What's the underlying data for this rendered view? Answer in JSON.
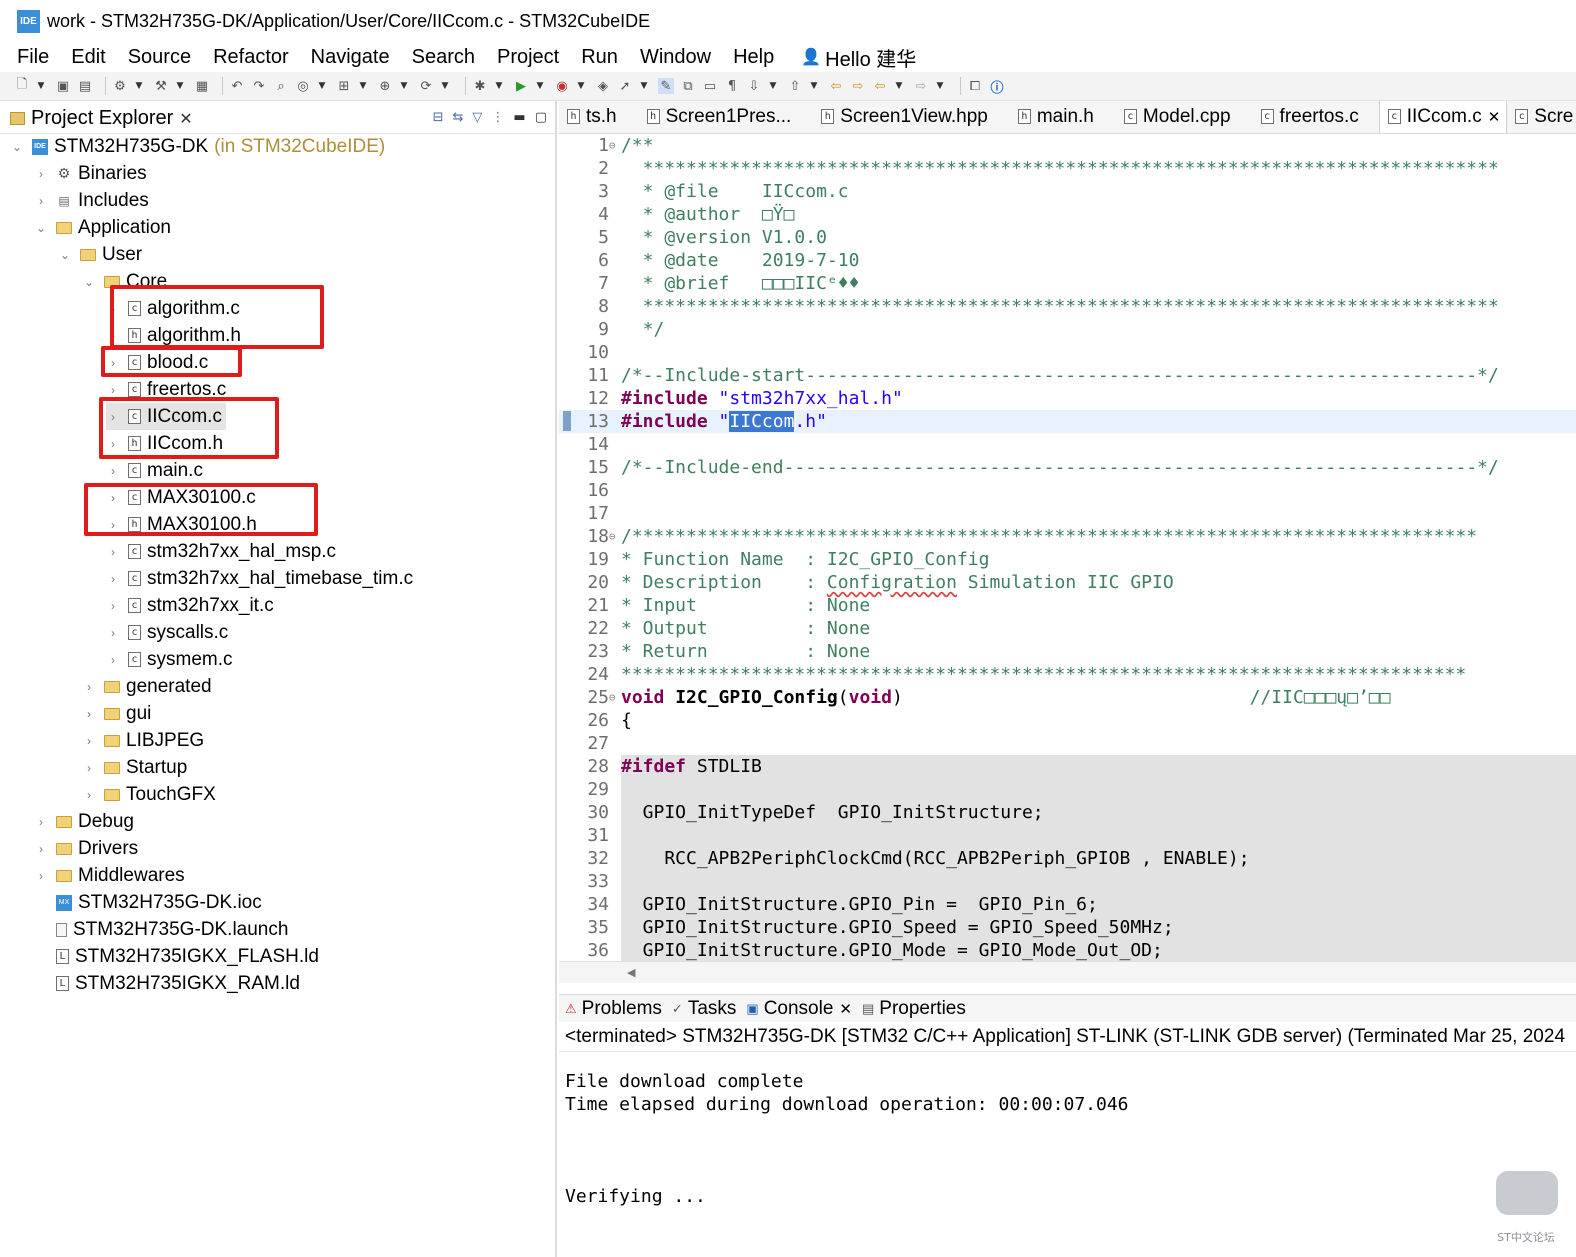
{
  "window": {
    "logo": "IDE",
    "title": "work - STM32H735G-DK/Application/User/Core/IICcom.c - STM32CubeIDE"
  },
  "menu": {
    "items": [
      "File",
      "Edit",
      "Source",
      "Refactor",
      "Navigate",
      "Search",
      "Project",
      "Run",
      "Window",
      "Help"
    ],
    "user": "Hello 建华"
  },
  "project_explorer": {
    "title": "Project Explorer",
    "project": "STM32H735G-DK",
    "project_suffix": "(in STM32CubeIDE)",
    "items": [
      {
        "label": "Binaries"
      },
      {
        "label": "Includes"
      },
      {
        "label": "Application"
      },
      {
        "label": "User"
      },
      {
        "label": "Core"
      },
      {
        "label": "algorithm.c"
      },
      {
        "label": "algorithm.h"
      },
      {
        "label": "blood.c"
      },
      {
        "label": "freertos.c"
      },
      {
        "label": "IICcom.c"
      },
      {
        "label": "IICcom.h"
      },
      {
        "label": "main.c"
      },
      {
        "label": "MAX30100.c"
      },
      {
        "label": "MAX30100.h"
      },
      {
        "label": "stm32h7xx_hal_msp.c"
      },
      {
        "label": "stm32h7xx_hal_timebase_tim.c"
      },
      {
        "label": "stm32h7xx_it.c"
      },
      {
        "label": "syscalls.c"
      },
      {
        "label": "sysmem.c"
      },
      {
        "label": "generated"
      },
      {
        "label": "gui"
      },
      {
        "label": "LIBJPEG"
      },
      {
        "label": "Startup"
      },
      {
        "label": "TouchGFX"
      },
      {
        "label": "Debug"
      },
      {
        "label": "Drivers"
      },
      {
        "label": "Middlewares"
      },
      {
        "label": "STM32H735G-DK.ioc"
      },
      {
        "label": "STM32H735G-DK.launch"
      },
      {
        "label": "STM32H735IGKX_FLASH.ld"
      },
      {
        "label": "STM32H735IGKX_RAM.ld"
      }
    ]
  },
  "editor": {
    "tabs": [
      "ts.h",
      "Screen1Pres...",
      "Screen1View.hpp",
      "main.h",
      "Model.cpp",
      "freertos.c",
      "IICcom.c",
      "Scre"
    ],
    "active_tab": "IICcom.c",
    "lines": [
      {
        "n": "1",
        "segs": [
          {
            "t": "/**",
            "c": "com"
          }
        ],
        "fold": "⊖"
      },
      {
        "n": "2",
        "segs": [
          {
            "t": "  *******************************************************************************",
            "c": "com"
          }
        ]
      },
      {
        "n": "3",
        "segs": [
          {
            "t": "  * @file    IICcom.c",
            "c": "com"
          }
        ]
      },
      {
        "n": "4",
        "segs": [
          {
            "t": "  * @author  □Ÿ□",
            "c": "com"
          }
        ]
      },
      {
        "n": "5",
        "segs": [
          {
            "t": "  * @version V1.0.0",
            "c": "com"
          }
        ]
      },
      {
        "n": "6",
        "segs": [
          {
            "t": "  * @date    2019-7-10",
            "c": "com"
          }
        ]
      },
      {
        "n": "7",
        "segs": [
          {
            "t": "  * @brief   □□□IICᵉ♦♦",
            "c": "com"
          }
        ]
      },
      {
        "n": "8",
        "segs": [
          {
            "t": "  *******************************************************************************",
            "c": "com"
          }
        ]
      },
      {
        "n": "9",
        "segs": [
          {
            "t": "  */",
            "c": "com"
          }
        ]
      },
      {
        "n": "10",
        "segs": []
      },
      {
        "n": "11",
        "segs": [
          {
            "t": "/*--Include-start--------------------------------------------------------------*/",
            "c": "com"
          }
        ]
      },
      {
        "n": "12",
        "segs": [
          {
            "t": "#include",
            "c": "kw"
          },
          {
            "t": " "
          },
          {
            "t": "\"stm32h7xx_hal.h\"",
            "c": "str"
          }
        ]
      },
      {
        "n": "13",
        "hl": true,
        "segs": [
          {
            "t": "#include",
            "c": "kw"
          },
          {
            "t": " "
          },
          {
            "t": "\"",
            "c": "str"
          },
          {
            "t": "IICcom",
            "c": "selword"
          },
          {
            "t": ".h\"",
            "c": "str"
          }
        ]
      },
      {
        "n": "14",
        "segs": []
      },
      {
        "n": "15",
        "segs": [
          {
            "t": "/*--Include-end----------------------------------------------------------------*/",
            "c": "com"
          }
        ]
      },
      {
        "n": "16",
        "segs": []
      },
      {
        "n": "17",
        "segs": []
      },
      {
        "n": "18",
        "fold": "⊖",
        "segs": [
          {
            "t": "/******************************************************************************",
            "c": "com"
          }
        ]
      },
      {
        "n": "19",
        "segs": [
          {
            "t": "* Function Name  : I2C_GPIO_Config",
            "c": "com"
          }
        ]
      },
      {
        "n": "20",
        "segs": [
          {
            "t": "* Description    : ",
            "c": "com"
          },
          {
            "t": "Configration",
            "c": "comsq"
          },
          {
            "t": " Simulation IIC GPIO",
            "c": "com"
          }
        ]
      },
      {
        "n": "21",
        "segs": [
          {
            "t": "* Input          : None",
            "c": "com"
          }
        ]
      },
      {
        "n": "22",
        "segs": [
          {
            "t": "* Output         : None",
            "c": "com"
          }
        ]
      },
      {
        "n": "23",
        "segs": [
          {
            "t": "* Return         : None",
            "c": "com"
          }
        ]
      },
      {
        "n": "24",
        "segs": [
          {
            "t": "****************************************************************************** ",
            "c": "com"
          }
        ]
      },
      {
        "n": "25",
        "fold": "⊖",
        "segs": [
          {
            "t": "void",
            "c": "kw"
          },
          {
            "t": " "
          },
          {
            "t": "I2C_GPIO_Config",
            "c": "fn"
          },
          {
            "t": "("
          },
          {
            "t": "void",
            "c": "kw"
          },
          {
            "t": ")"
          },
          {
            "t": "                                //IIC□□□ų□’□□",
            "c": "com"
          }
        ]
      },
      {
        "n": "26",
        "segs": [
          {
            "t": "{"
          }
        ]
      },
      {
        "n": "27",
        "segs": []
      },
      {
        "n": "28",
        "shade": true,
        "segs": [
          {
            "t": "#ifdef",
            "c": "kw"
          },
          {
            "t": " STDLIB"
          }
        ]
      },
      {
        "n": "29",
        "shade": true,
        "segs": []
      },
      {
        "n": "30",
        "shade": true,
        "segs": [
          {
            "t": "  GPIO_InitTypeDef  GPIO_InitStructure;"
          }
        ]
      },
      {
        "n": "31",
        "shade": true,
        "segs": []
      },
      {
        "n": "32",
        "shade": true,
        "segs": [
          {
            "t": "    RCC_APB2PeriphClockCmd(RCC_APB2Periph_GPIOB , ENABLE);"
          }
        ]
      },
      {
        "n": "33",
        "shade": true,
        "segs": []
      },
      {
        "n": "34",
        "shade": true,
        "segs": [
          {
            "t": "  GPIO_InitStructure.GPIO_Pin =  GPIO_Pin_6;"
          }
        ]
      },
      {
        "n": "35",
        "shade": true,
        "segs": [
          {
            "t": "  GPIO_InitStructure.GPIO_Speed = GPIO_Speed_50MHz;"
          }
        ]
      },
      {
        "n": "36",
        "shade": true,
        "segs": [
          {
            "t": "  GPIO_InitStructure.GPIO_Mode = GPIO_Mode_Out_OD;"
          }
        ]
      }
    ]
  },
  "console": {
    "tabs": [
      "Problems",
      "Tasks",
      "Console",
      "Properties"
    ],
    "active_tab": "Console",
    "header": "<terminated> STM32H735G-DK [STM32 C/C++ Application] ST-LINK (ST-LINK GDB server) (Terminated Mar 25, 2024",
    "lines": [
      "File download complete",
      "Time elapsed during download operation: 00:00:07.046",
      "",
      "",
      "",
      "Verifying ..."
    ]
  },
  "watermark": {
    "text": "ST中文论坛"
  },
  "colors": {
    "highlight_box": "#e01b1b",
    "selection": "#3b78d3",
    "comment": "#3f7f5f",
    "keyword": "#7f0055",
    "string": "#2a00ff"
  }
}
